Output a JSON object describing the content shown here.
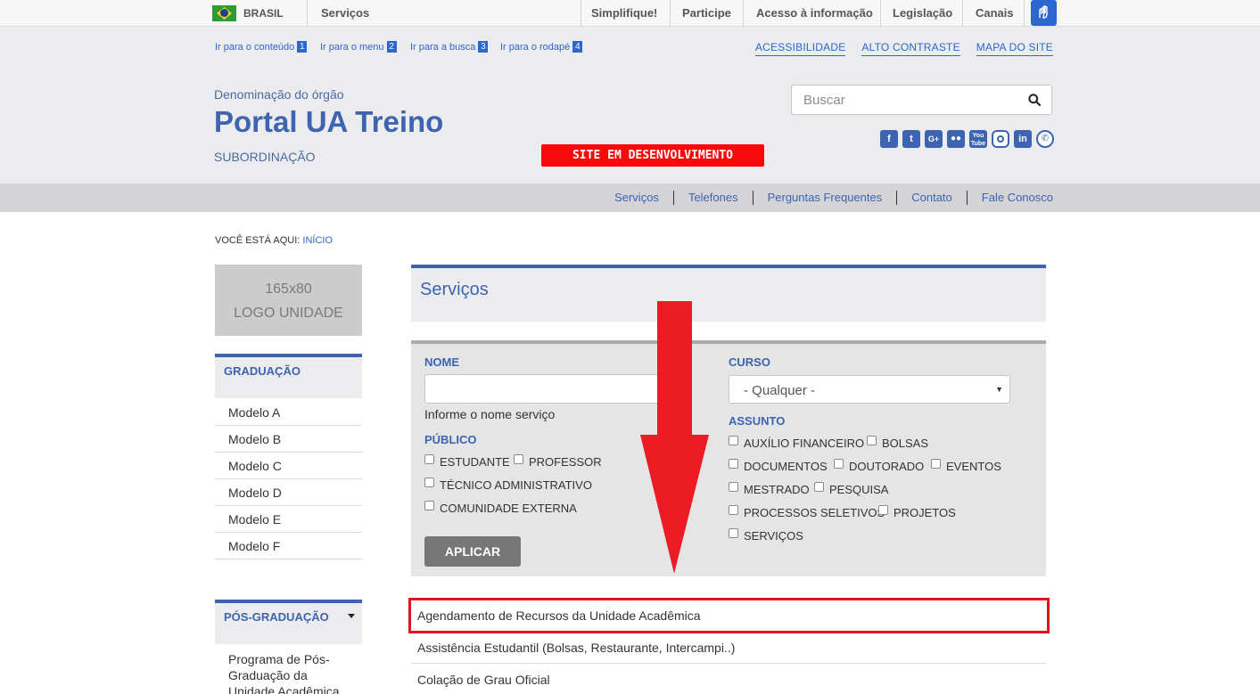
{
  "govbar": {
    "country": "BRASIL",
    "servicos": "Serviços",
    "links": [
      "Simplifique!",
      "Participe",
      "Acesso à informação",
      "Legislação",
      "Canais"
    ]
  },
  "header": {
    "skip_links": [
      {
        "label": "Ir para o conteúdo",
        "key": "1"
      },
      {
        "label": "Ir para o menu",
        "key": "2"
      },
      {
        "label": "Ir para a busca",
        "key": "3"
      },
      {
        "label": "Ir para o rodapé",
        "key": "4"
      }
    ],
    "accessibility_links": [
      "ACESSIBILIDADE",
      "ALTO CONTRASTE",
      "MAPA DO SITE"
    ],
    "orgao": "Denominação do órgão",
    "title": "Portal UA Treino",
    "subordinacao": "SUBORDINAÇÃO",
    "dev_badge": "SITE EM DESENVOLVIMENTO",
    "search_placeholder": "Buscar",
    "social_icons": [
      "facebook-icon",
      "twitter-icon",
      "google-plus-icon",
      "flickr-icon",
      "youtube-icon",
      "instagram-icon",
      "linkedin-icon",
      "whatsapp-icon"
    ]
  },
  "service_nav": [
    "Serviços",
    "Telefones",
    "Perguntas Frequentes",
    "Contato",
    "Fale Conosco"
  ],
  "breadcrumb": {
    "prefix": "VOCÊ ESTÁ AQUI:",
    "home": "INÍCIO"
  },
  "sidebar": {
    "logo_line1": "165x80",
    "logo_line2": "LOGO UNIDADE",
    "graduacao_title": "GRADUAÇÃO",
    "graduacao_items": [
      "Modelo A",
      "Modelo B",
      "Modelo C",
      "Modelo D",
      "Modelo E",
      "Modelo F"
    ],
    "pos_title": "PÓS-GRADUAÇÃO",
    "pos_items": [
      "Programa de Pós-Graduação da Unidade Acadêmica"
    ]
  },
  "main": {
    "title": "Serviços",
    "filter": {
      "nome_label": "NOME",
      "nome_hint": "Informe o nome serviço",
      "curso_label": "CURSO",
      "curso_value": "- Qualquer -",
      "publico_label": "PÚBLICO",
      "publico_options": [
        "ESTUDANTE",
        "PROFESSOR",
        "TÉCNICO ADMINISTRATIVO",
        "COMUNIDADE EXTERNA"
      ],
      "assunto_label": "ASSUNTO",
      "assunto_options": [
        "AUXÍLIO FINANCEIRO",
        "BOLSAS",
        "DOCUMENTOS",
        "DOUTORADO",
        "EVENTOS",
        "MESTRADO",
        "PESQUISA",
        "PROCESSOS SELETIVOS",
        "PROJETOS",
        "SERVIÇOS"
      ],
      "apply_label": "APLICAR"
    },
    "results": [
      "Agendamento de Recursos da Unidade Acadêmica",
      "Assistência Estudantil (Bolsas, Restaurante, Intercampi..)",
      "Colação de Grau Oficial"
    ]
  },
  "annotation": {
    "arrow_color": "#ed1c24",
    "highlight_color": "#e0161d"
  }
}
